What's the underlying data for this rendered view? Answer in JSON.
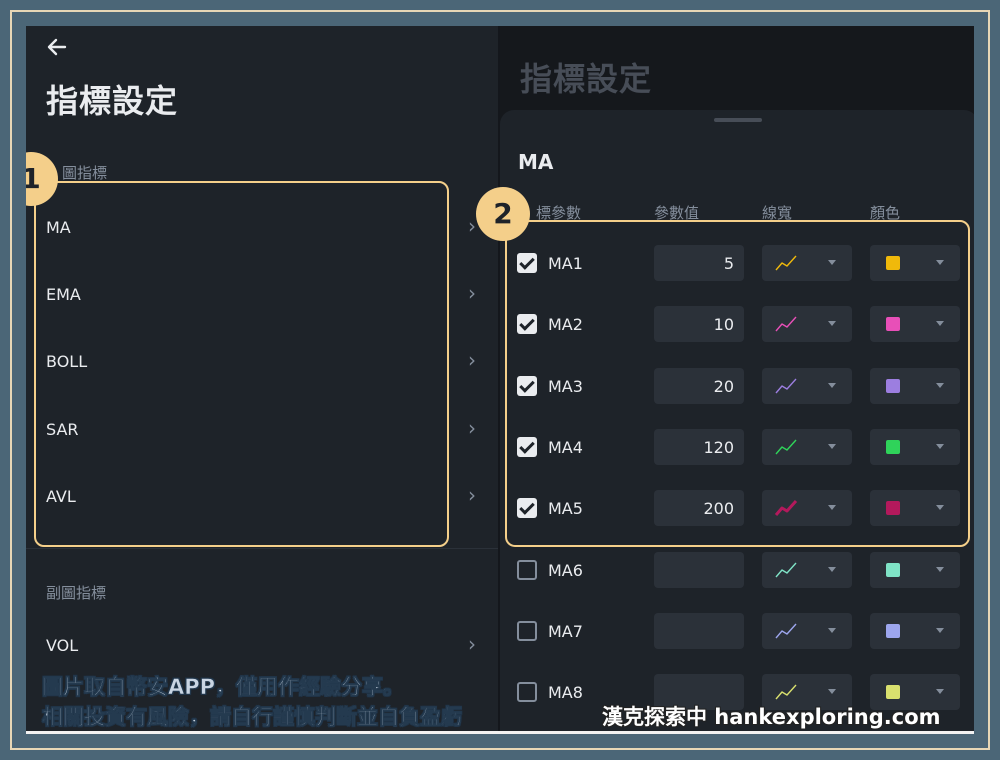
{
  "header": {
    "title": "指標設定",
    "back_icon": "arrow-left-icon"
  },
  "main_section": {
    "label": "圖指標",
    "items": [
      {
        "label": "MA"
      },
      {
        "label": "EMA"
      },
      {
        "label": "BOLL"
      },
      {
        "label": "SAR"
      },
      {
        "label": "AVL"
      }
    ]
  },
  "sub_section": {
    "label": "副圖指標",
    "items": [
      {
        "label": "VOL"
      }
    ]
  },
  "sheet": {
    "background_title": "指標設定",
    "title": "MA",
    "columns": {
      "param": "標參數",
      "value": "參數值",
      "width": "線寬",
      "color": "顏色"
    },
    "rows": [
      {
        "label": "MA1",
        "checked": true,
        "value": "5",
        "color": "#f0b90b"
      },
      {
        "label": "MA2",
        "checked": true,
        "value": "10",
        "color": "#e84fb8"
      },
      {
        "label": "MA3",
        "checked": true,
        "value": "20",
        "color": "#9c7ee0"
      },
      {
        "label": "MA4",
        "checked": true,
        "value": "120",
        "color": "#2fd35a"
      },
      {
        "label": "MA5",
        "checked": true,
        "value": "200",
        "color": "#b3195c"
      },
      {
        "label": "MA6",
        "checked": false,
        "value": "",
        "color": "#7fe3c6"
      },
      {
        "label": "MA7",
        "checked": false,
        "value": "",
        "color": "#9da6ee"
      },
      {
        "label": "MA8",
        "checked": false,
        "value": "",
        "color": "#d9e06e"
      }
    ]
  },
  "annotations": {
    "badge1": "1",
    "badge2": "2"
  },
  "caption": {
    "line1": "圖片取自幣安APP，僅用作經驗分享。",
    "line2": "相關投資有風險，請自行謹慎判斷並自負盈虧",
    "site": "漢克探索中 hankexploring.com"
  },
  "colors": {
    "accent": "#f4cf8a",
    "background": "#1e2329"
  }
}
